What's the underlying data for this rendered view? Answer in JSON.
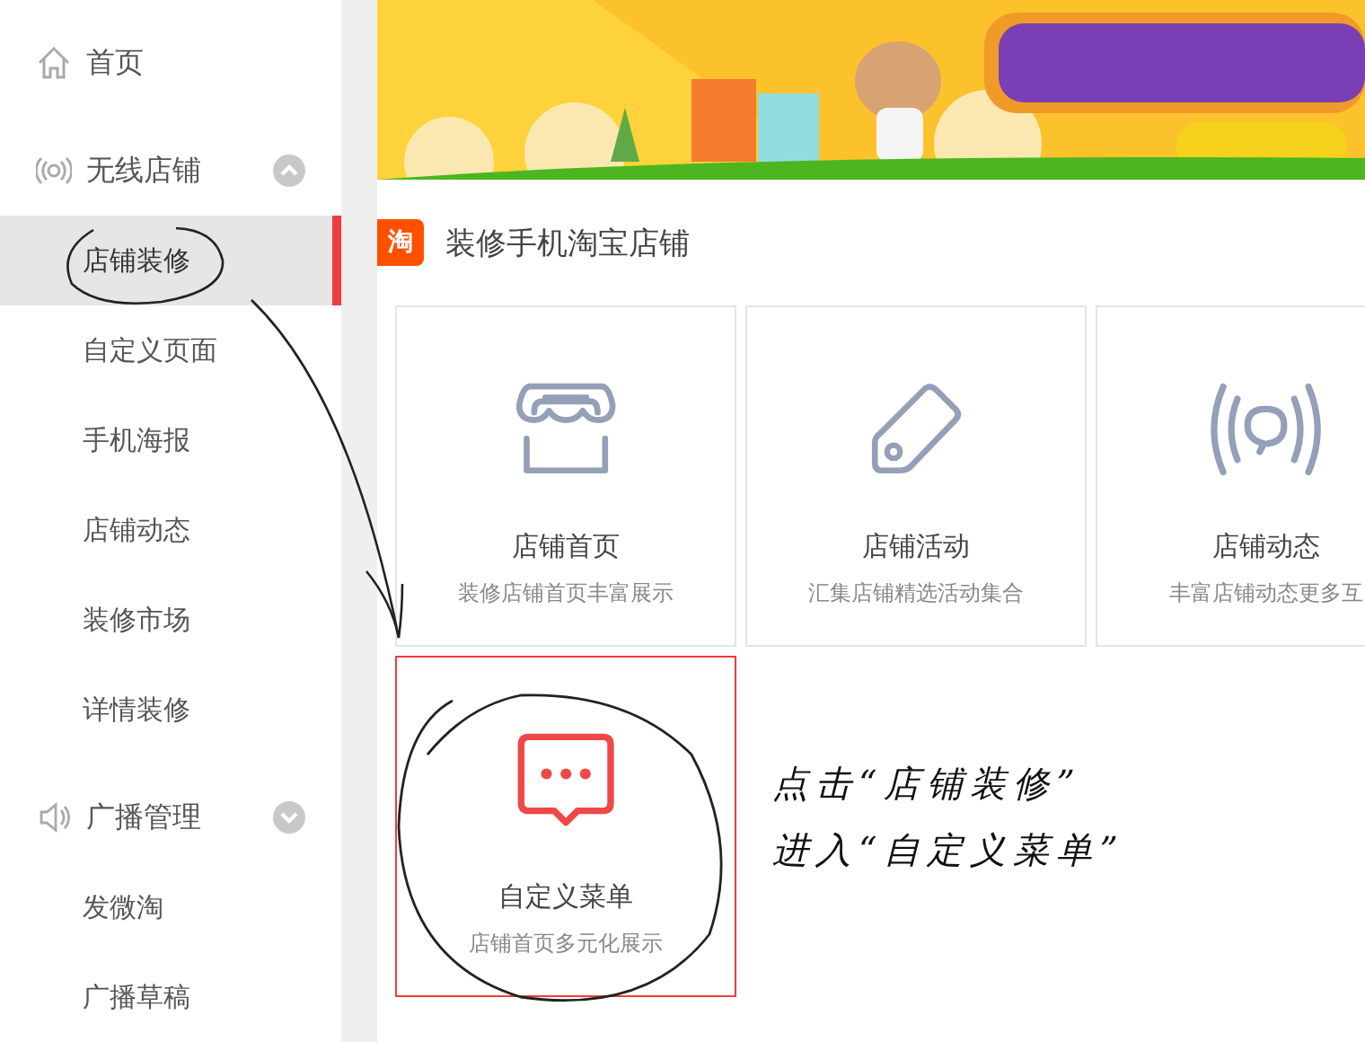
{
  "sidebar": {
    "items": [
      {
        "label": "首页",
        "kind": "home"
      },
      {
        "label": "无线店铺",
        "kind": "wireless",
        "expanded": true,
        "children": [
          {
            "label": "店铺装修",
            "selected": true
          },
          {
            "label": "自定义页面",
            "selected": false
          },
          {
            "label": "手机海报",
            "selected": false
          },
          {
            "label": "店铺动态",
            "selected": false
          },
          {
            "label": "装修市场",
            "selected": false
          },
          {
            "label": "详情装修",
            "selected": false
          }
        ]
      },
      {
        "label": "广播管理",
        "kind": "broadcast",
        "expanded": false,
        "children": [
          {
            "label": "发微淘",
            "selected": false
          },
          {
            "label": "广播草稿",
            "selected": false
          }
        ]
      }
    ]
  },
  "section": {
    "logo": "淘",
    "title": "装修手机淘宝店铺"
  },
  "cards": [
    {
      "kind": "store",
      "title": "店铺首页",
      "description": "装修店铺首页丰富展示",
      "selected": false
    },
    {
      "kind": "tag",
      "title": "店铺活动",
      "description": "汇集店铺精选活动集合",
      "selected": false
    },
    {
      "kind": "broadcast",
      "title": "店铺动态",
      "description": "丰富店铺动态更多互",
      "selected": false
    },
    {
      "kind": "chat",
      "title": "自定义菜单",
      "description": "店铺首页多元化展示",
      "selected": true
    }
  ],
  "annotation": {
    "lines": [
      "点击“店铺装修”",
      "进入“自定义菜单”"
    ]
  }
}
